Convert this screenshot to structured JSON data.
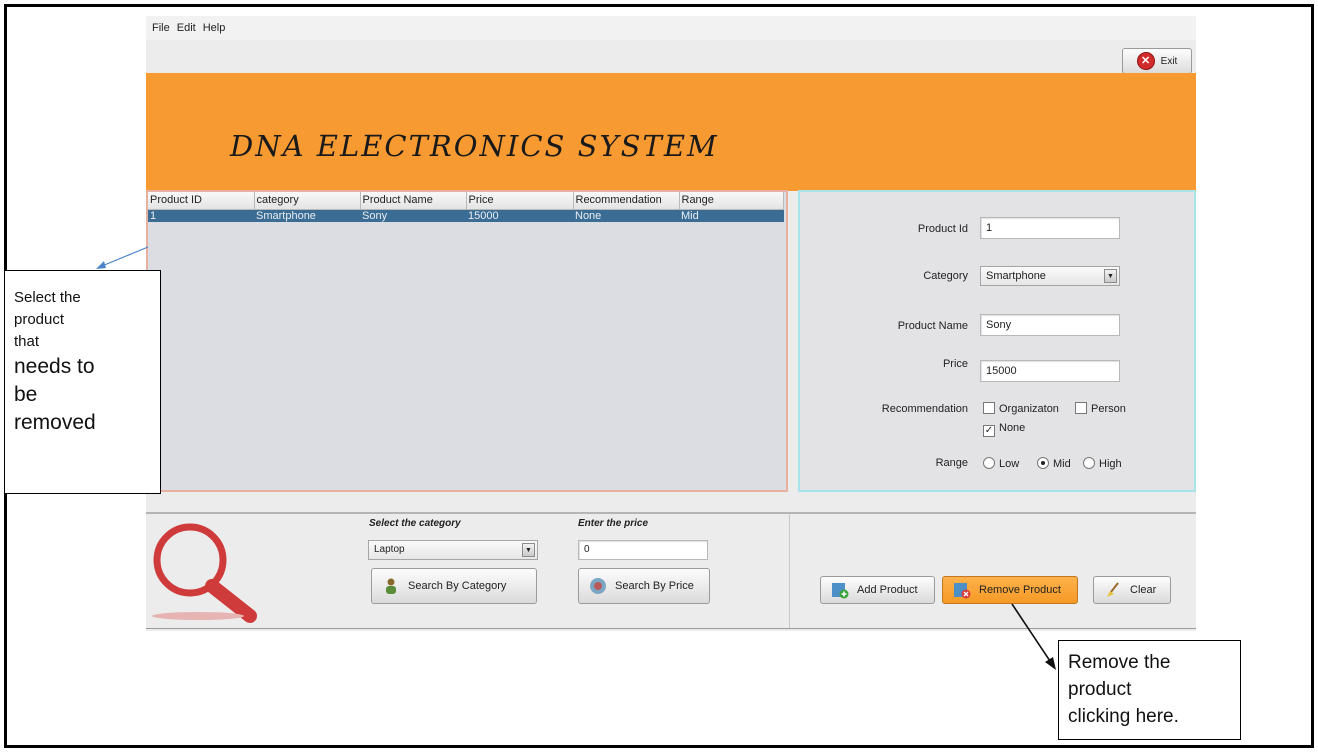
{
  "menu": [
    "File",
    "Edit",
    "Help"
  ],
  "exit_label": "Exit",
  "banner_title": "DNA ELECTRONICS SYSTEM",
  "table": {
    "headers": [
      "Product ID",
      "category",
      "Product Name",
      "Price",
      "Recommendation",
      "Range"
    ],
    "rows": [
      [
        "1",
        "Smartphone",
        "Sony",
        "15000",
        "None",
        "Mid"
      ]
    ]
  },
  "form": {
    "product_id_label": "Product Id",
    "product_id_value": "1",
    "category_label": "Category",
    "category_value": "Smartphone",
    "product_name_label": "Product Name",
    "product_name_value": "Sony",
    "price_label": "Price",
    "price_value": "15000",
    "recommendation_label": "Recommendation",
    "rec_organization": "Organizaton",
    "rec_person": "Person",
    "rec_none": "None",
    "range_label": "Range",
    "range_low": "Low",
    "range_mid": "Mid",
    "range_high": "High"
  },
  "search": {
    "category_label": "Select the category",
    "category_value": "Laptop",
    "price_label": "Enter the price",
    "price_value": "0",
    "search_by_category": "Search By Category",
    "search_by_price": "Search By Price"
  },
  "actions": {
    "add": "Add Product",
    "remove": "Remove Product",
    "clear": "Clear"
  },
  "callouts": {
    "select_lines": [
      "Select the",
      "product",
      "that",
      "needs to",
      "be",
      "removed"
    ],
    "remove_lines": [
      "Remove the",
      "product",
      "clicking here."
    ]
  }
}
